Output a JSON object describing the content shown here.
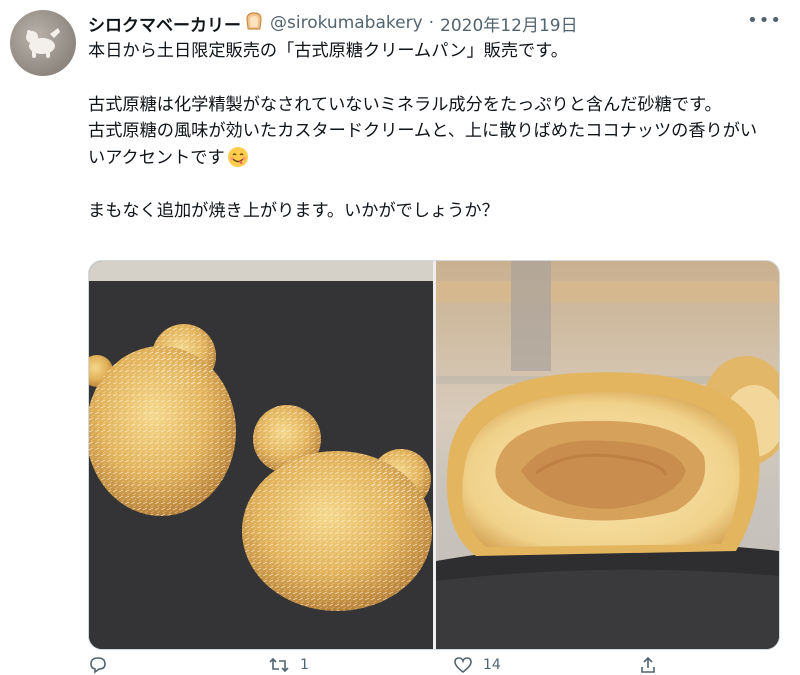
{
  "tweet": {
    "display_name": "シロクマベーカリー",
    "name_icon": "bread-emoji",
    "handle": "@sirokumabakery",
    "separator": "·",
    "date": "2020年12月19日",
    "more": "•••",
    "paragraphs": [
      "本日から土日限定販売の「古式原糖クリームパン」販売です。",
      "古式原糖は化学精製がなされていないミネラル成分をたっぷりと含んだ砂糖です。",
      "古式原糖の風味が効いたカスタードクリームと、上に散りばめたココナッツの香りがいいアクセントです",
      "まもなく追加が焼き上がります。いかがでしょうか？"
    ],
    "trailing_emoji": "yummy-face-emoji",
    "photos": [
      {
        "subject": "two bear-shaped buns with coconut topping on slate"
      },
      {
        "subject": "cream bun cut in half showing custard filling"
      }
    ],
    "actions": {
      "reply_icon": "reply-icon",
      "retweet_icon": "retweet-icon",
      "retweet_count": "1",
      "like_icon": "heart-icon",
      "like_count": "14",
      "share_icon": "share-icon"
    }
  },
  "colors": {
    "text": "#0f1419",
    "secondary": "#536471",
    "border": "#cfd9de"
  }
}
